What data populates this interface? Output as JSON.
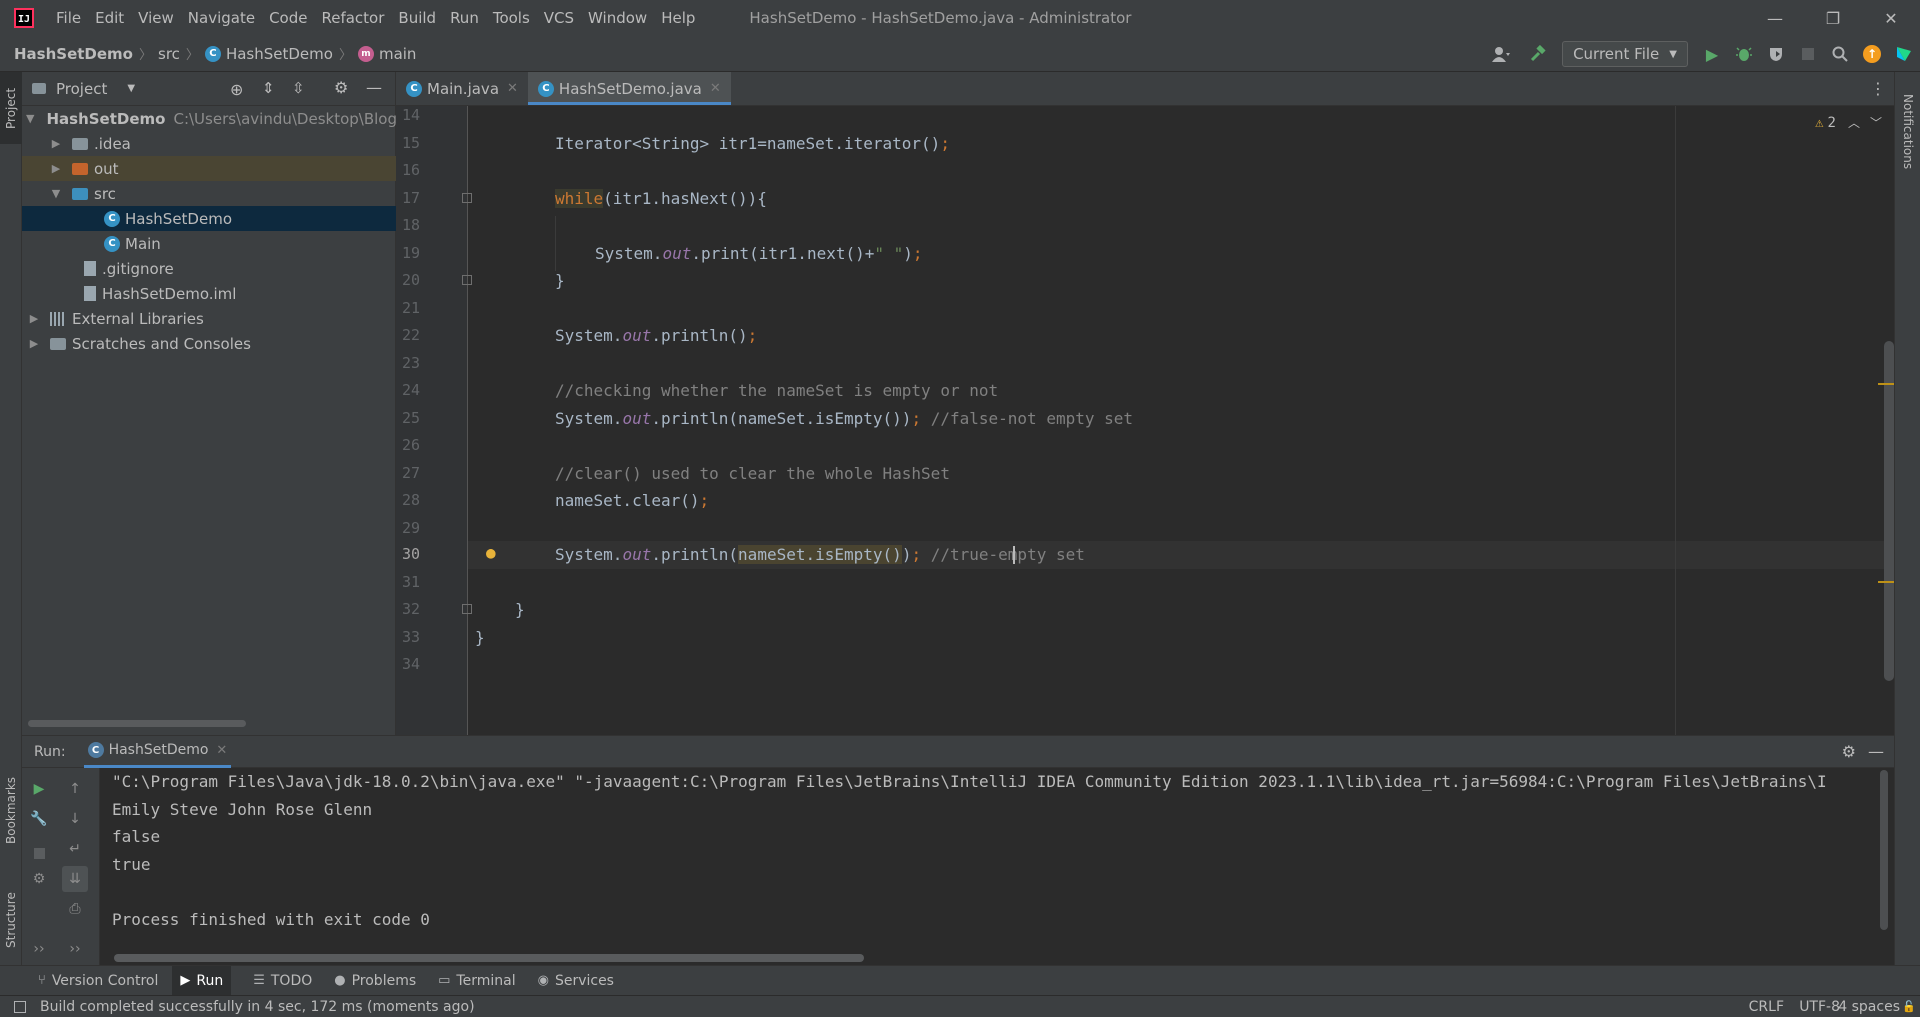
{
  "titlebar": {
    "logo_text": "IJ",
    "menu": [
      "File",
      "Edit",
      "View",
      "Navigate",
      "Code",
      "Refactor",
      "Build",
      "Run",
      "Tools",
      "VCS",
      "Window",
      "Help"
    ],
    "window_title": "HashSetDemo - HashSetDemo.java - Administrator",
    "min": "—",
    "restore": "❐",
    "close": "✕"
  },
  "navbar": {
    "project": "HashSetDemo",
    "folder": "src",
    "class_name": "HashSetDemo",
    "method": "main",
    "run_config": "Current File"
  },
  "stripes": {
    "project": "Project",
    "bookmarks": "Bookmarks",
    "structure": "Structure",
    "notifications": "Notifications"
  },
  "project_panel": {
    "title": "Project",
    "tree": [
      {
        "label": "HashSetDemo",
        "path": "C:\\Users\\avindu\\Desktop\\Blogs",
        "bold": true
      },
      {
        "label": ".idea"
      },
      {
        "label": "out"
      },
      {
        "label": "src"
      },
      {
        "label": "HashSetDemo"
      },
      {
        "label": "Main"
      },
      {
        "label": ".gitignore"
      },
      {
        "label": "HashSetDemo.iml"
      },
      {
        "label": "External Libraries"
      },
      {
        "label": "Scratches and Consoles"
      }
    ]
  },
  "editor_tabs": [
    {
      "label": "Main.java"
    },
    {
      "label": "HashSetDemo.java"
    }
  ],
  "editor": {
    "inspection_count": "2",
    "line_numbers": [
      "14",
      "15",
      "16",
      "17",
      "18",
      "19",
      "20",
      "21",
      "22",
      "23",
      "24",
      "25",
      "26",
      "27",
      "28",
      "29",
      "30",
      "31",
      "32",
      "33",
      "34"
    ],
    "code": {
      "l15": "Iterator<String> itr1=nameSet.iterator()",
      "l17_kw": "while",
      "l17_rest": "(itr1.hasNext()){",
      "l19_a": "System.",
      "l19_out": "out",
      "l19_b": ".print(itr1.next()+",
      "l19_str": "\" \"",
      "l19_c": ")",
      "l20": "}",
      "l22_a": "System.",
      "l22_out": "out",
      "l22_b": ".println()",
      "l24": "//checking whether the nameSet is empty or not",
      "l25_a": "System.",
      "l25_out": "out",
      "l25_b": ".println(nameSet.isEmpty())",
      "l25_cm": "//false-not empty set",
      "l27": "//clear() used to clear the whole HashSet",
      "l28": "nameSet.clear()",
      "l30_a": "System.",
      "l30_out": "out",
      "l30_b": ".println(",
      "l30_hl": "nameSet.isEmpty()",
      "l30_c": ")",
      "l30_cm": "//true-empty set",
      "l32": "}",
      "l33": "}",
      "semi": ";"
    }
  },
  "run_panel": {
    "label": "Run:",
    "tab": "HashSetDemo",
    "console": [
      "\"C:\\Program Files\\Java\\jdk-18.0.2\\bin\\java.exe\" \"-javaagent:C:\\Program Files\\JetBrains\\IntelliJ IDEA Community Edition 2023.1.1\\lib\\idea_rt.jar=56984:C:\\Program Files\\JetBrains\\I",
      "Emily Steve John Rose Glenn",
      "false",
      "true",
      "",
      "Process finished with exit code 0"
    ]
  },
  "tool_tabs": [
    "Version Control",
    "Run",
    "TODO",
    "Problems",
    "Terminal",
    "Services"
  ],
  "statusbar": {
    "message": "Build completed successfully in 4 sec, 172 ms (moments ago)",
    "line_sep": "CRLF",
    "encoding": "UTF-8",
    "indent": "4 spaces"
  }
}
